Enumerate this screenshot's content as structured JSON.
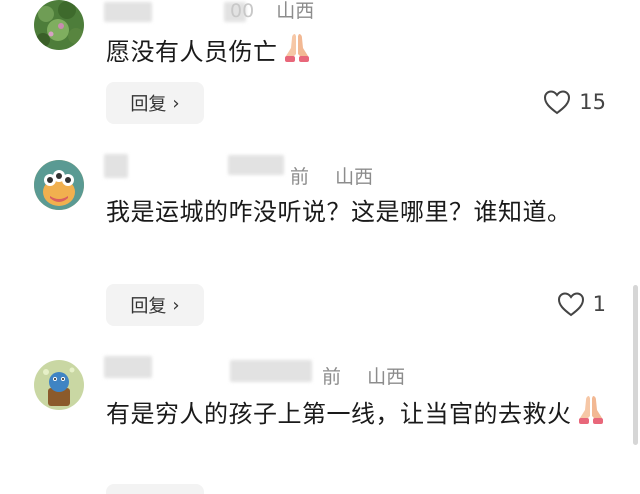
{
  "comments": [
    {
      "meta_time": "00",
      "meta_location": "山西",
      "text": "愿没有人员伤亡",
      "reply_label": "回复",
      "like_count": "15"
    },
    {
      "meta_time": "前",
      "meta_location": "山西",
      "text": "我是运城的咋没听说？这是哪里？谁知道。",
      "reply_label": "回复",
      "like_count": "1"
    },
    {
      "meta_time": "前",
      "meta_location": "山西",
      "text": "有是穷人的孩子上第一线，让当官的去救火",
      "reply_label": "回复",
      "like_count": ""
    }
  ],
  "icons": {
    "like": "heart-outline-icon",
    "reply_chevron": "chevron-right-icon",
    "emoji": "folded-hands-emoji"
  },
  "colors": {
    "meta": "#8c8c8c",
    "text": "#1a1a1a",
    "button_bg": "#f3f3f3"
  }
}
